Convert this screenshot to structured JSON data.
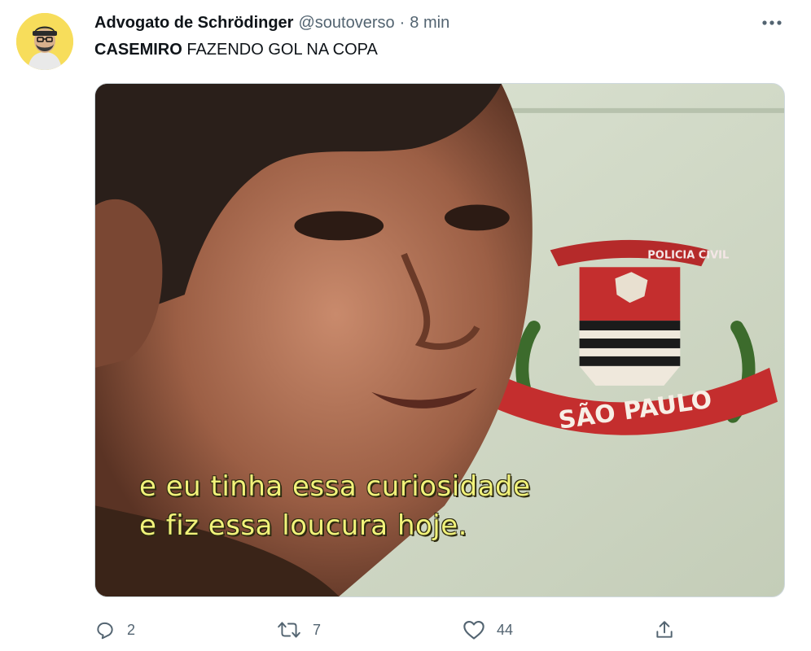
{
  "tweet": {
    "display_name": "Advogato de Schrödinger",
    "handle": "@soutoverso",
    "separator": "·",
    "time": "8 min",
    "text_bold": "CASEMIRO",
    "text_rest": " FAZENDO GOL NA COPA"
  },
  "media": {
    "subtitle_line1": "e eu tinha essa curiosidade",
    "subtitle_line2": "e fiz essa loucura hoje.",
    "crest_top": "POLICIA CIVIL",
    "crest_banner": "SÃO PAULO"
  },
  "actions": {
    "reply_count": "2",
    "retweet_count": "7",
    "like_count": "44"
  },
  "colors": {
    "text": "#0f1419",
    "secondary": "#536471",
    "subtitle": "#f1f27a",
    "avatar_bg": "#f7dd5b"
  },
  "icons": [
    "more-icon",
    "reply-icon",
    "retweet-icon",
    "like-icon",
    "share-icon"
  ]
}
